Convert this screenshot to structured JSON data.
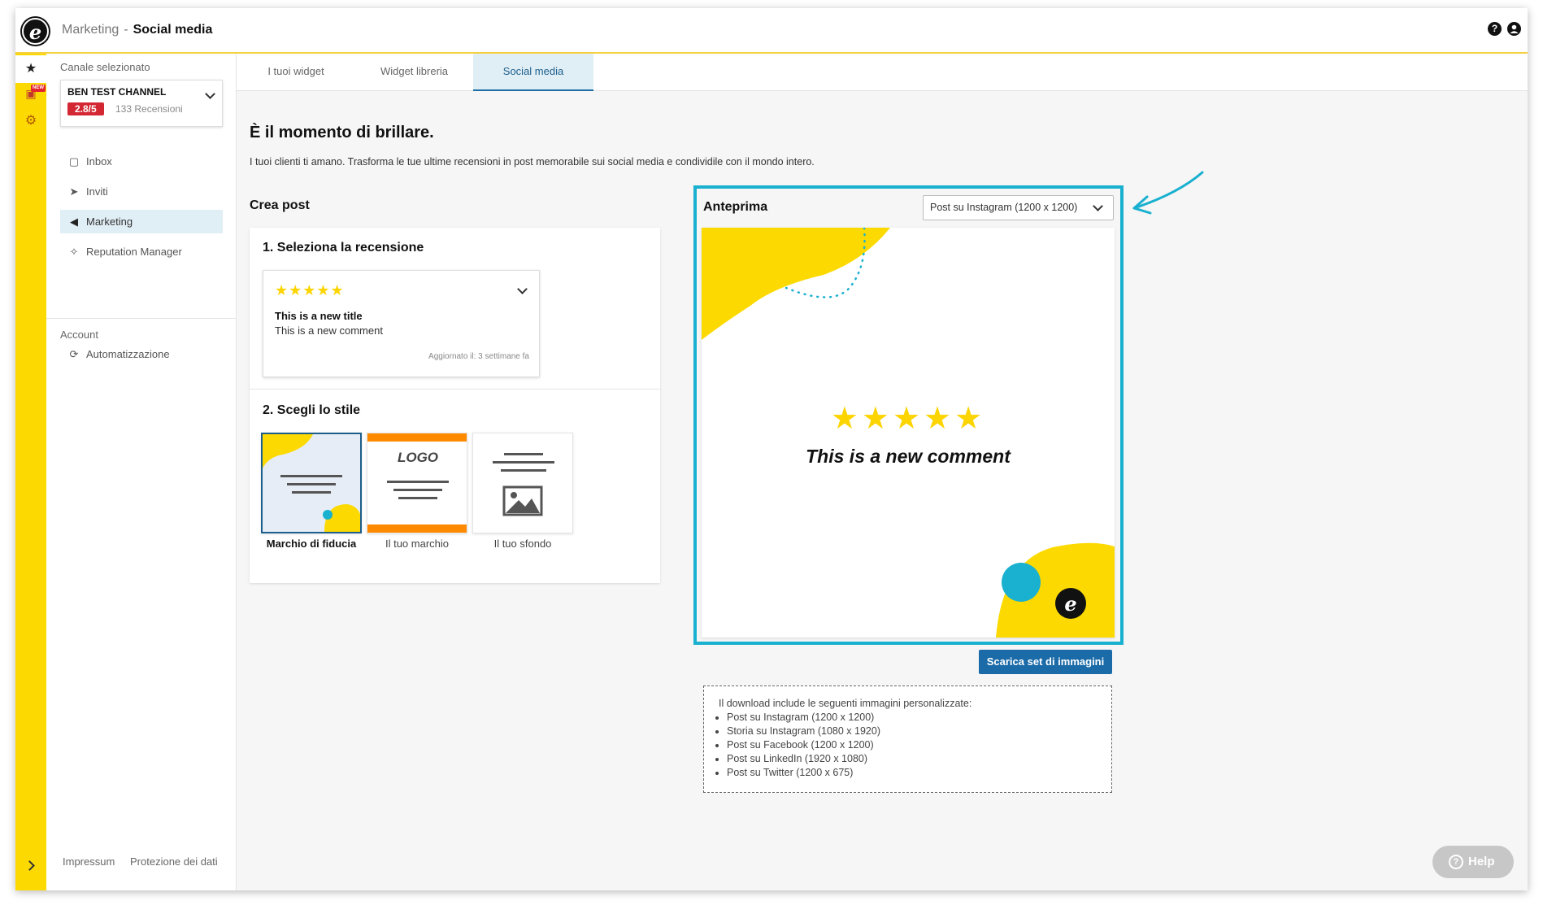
{
  "header": {
    "logo": "e",
    "section": "Marketing",
    "separator": "-",
    "page": "Social media",
    "help_icon": "?",
    "user_icon": "user-icon"
  },
  "rail": {
    "items": [
      {
        "icon": "star-icon",
        "glyph": "★"
      },
      {
        "icon": "chart-icon",
        "glyph": "▣",
        "badge": "NEW"
      },
      {
        "icon": "gear-icon",
        "glyph": "⚙"
      }
    ]
  },
  "sidebar": {
    "channel_label": "Canale selezionato",
    "channel_name": "BEN TEST CHANNEL",
    "rating": "2.8/5",
    "reviews": "133 Recensioni",
    "nav": [
      {
        "label": "Inbox",
        "glyph": "▢"
      },
      {
        "label": "Inviti",
        "glyph": "➤"
      },
      {
        "label": "Marketing",
        "glyph": "◀"
      },
      {
        "label": "Reputation Manager",
        "glyph": "✧"
      }
    ],
    "account_label": "Account",
    "account_nav": [
      {
        "label": "Automatizzazione",
        "glyph": "⟳"
      }
    ],
    "footer": {
      "impressum": "Impressum",
      "privacy": "Protezione dei dati"
    }
  },
  "tabs": [
    {
      "label": "I tuoi widget"
    },
    {
      "label": "Widget libreria"
    },
    {
      "label": "Social media"
    }
  ],
  "main": {
    "title": "È il momento di brillare.",
    "subtitle": "I tuoi clienti ti amano. Trasforma le tue ultime recensioni in post memorabile sui social media e condividile con il mondo intero.",
    "create_title": "Crea post",
    "step1_title": "1. Seleziona la recensione",
    "review": {
      "stars": "★★★★★",
      "title": "This is a new title",
      "comment": "This is a new comment",
      "updated": "Aggiornato il: 3 settimane fa"
    },
    "step2_title": "2. Scegli lo stile",
    "styles": [
      {
        "label": "Marchio di fiducia"
      },
      {
        "label": "Il tuo marchio",
        "logo_text": "LOGO"
      },
      {
        "label": "Il tuo sfondo"
      }
    ],
    "preview": {
      "title": "Anteprima",
      "format": "Post su Instagram (1200 x 1200)",
      "stars": "★★★★★",
      "comment": "This is a new comment",
      "logo": "e"
    },
    "download_button": "Scarica set di immagini",
    "info": {
      "intro": "Il download include le seguenti immagini personalizzate:",
      "items": [
        "Post su Instagram (1200 x 1200)",
        "Storia su Instagram (1080 x 1920)",
        "Post su Facebook (1200 x 1200)",
        "Post su LinkedIn (1920 x 1080)",
        "Post su Twitter (1200 x 675)"
      ]
    }
  },
  "help_button": "Help",
  "colors": {
    "brand_yellow": "#fcd900",
    "accent_blue": "#1b6ba8",
    "highlight_cyan": "#1ab0cf",
    "rating_red": "#d32733"
  }
}
